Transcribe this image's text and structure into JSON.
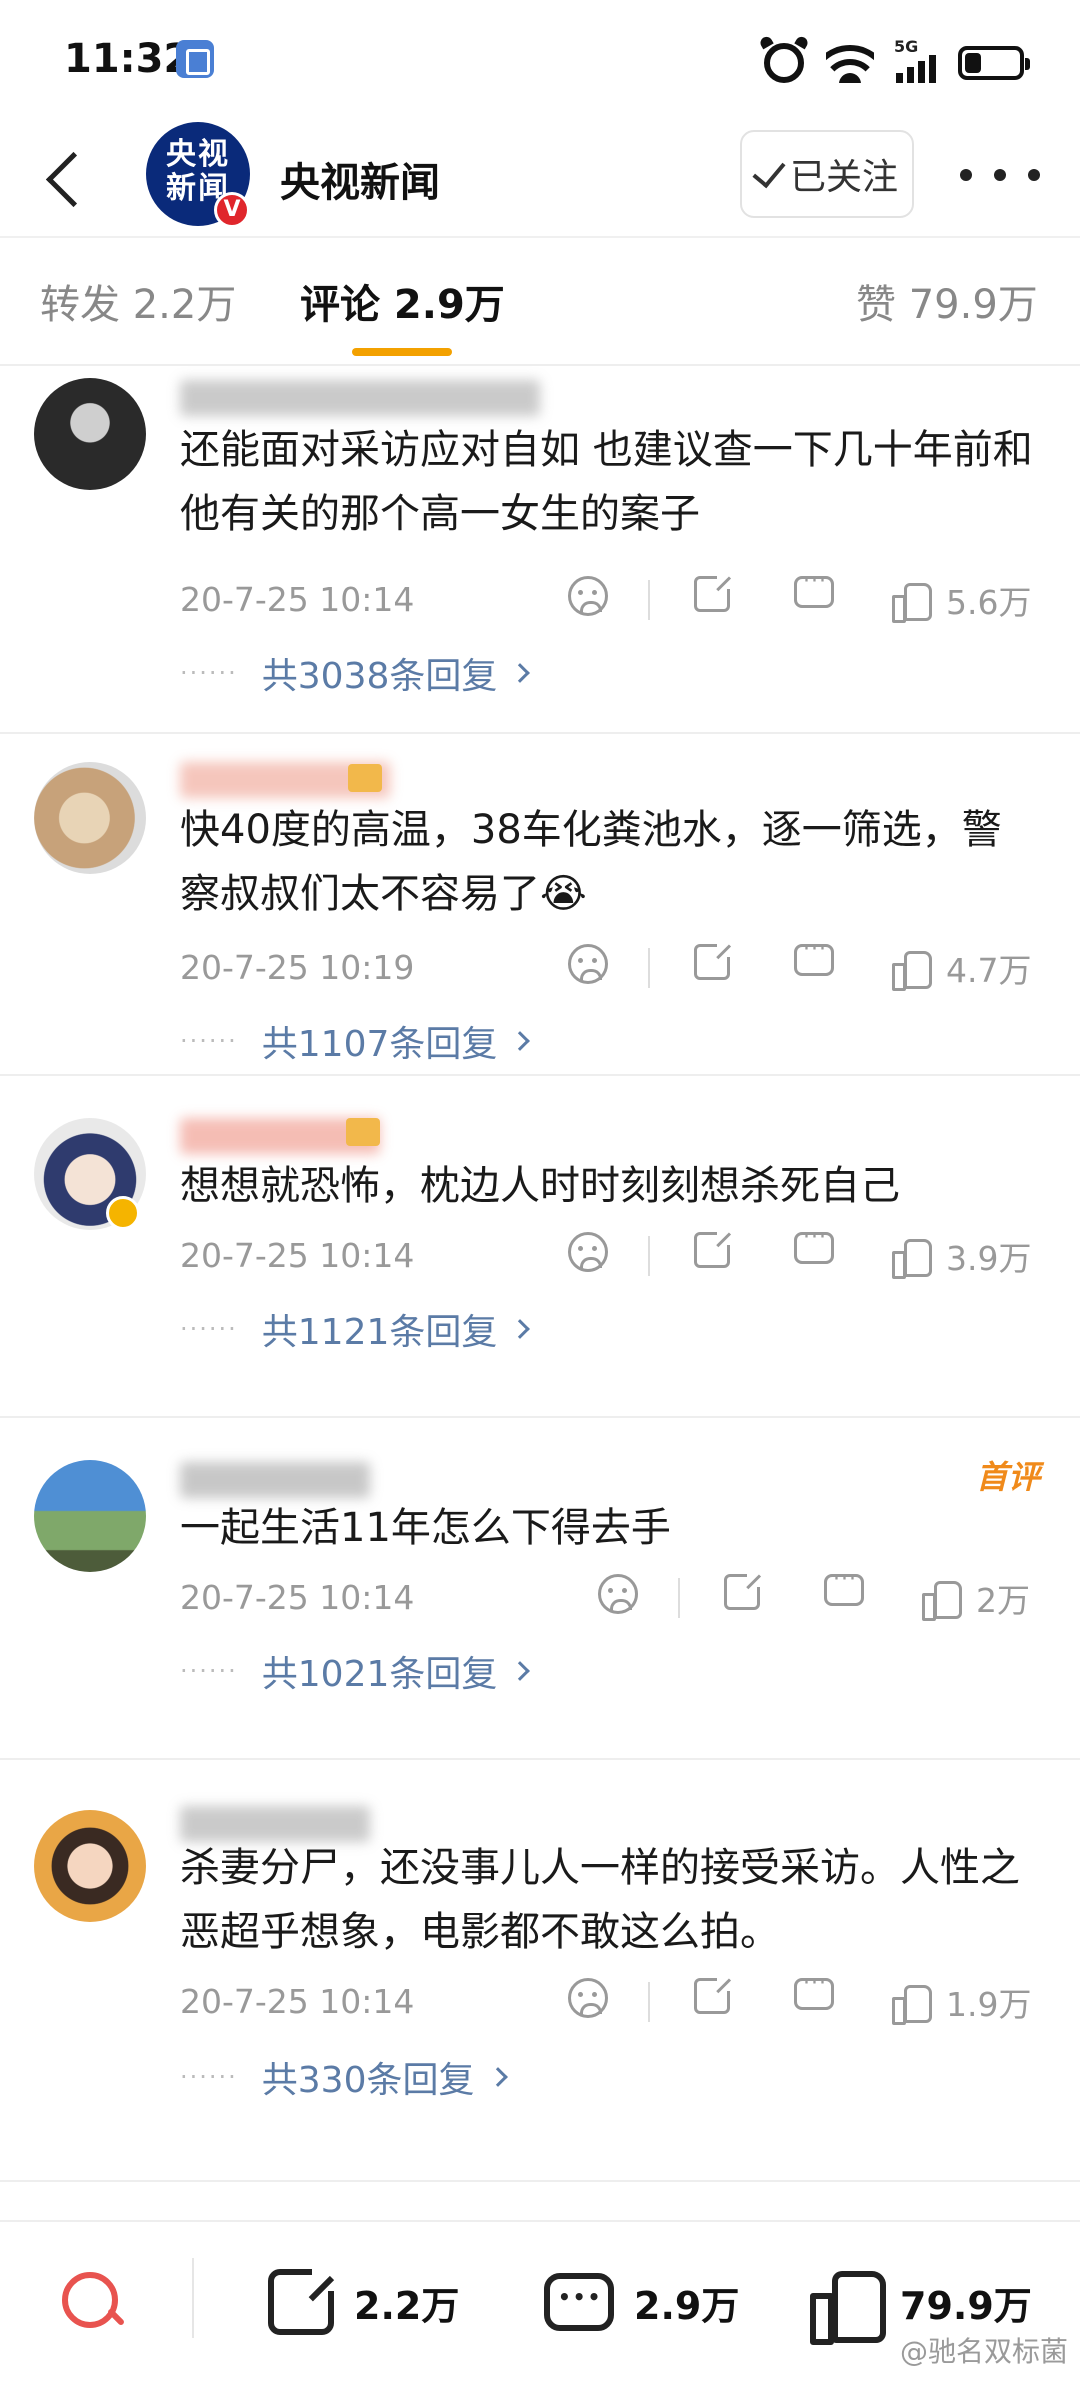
{
  "status_bar": {
    "time": "11:32",
    "network": "5G"
  },
  "header": {
    "account_name": "央视新闻",
    "logo_text_1": "央视",
    "logo_text_2": "新闻",
    "verified_mark": "V",
    "follow_label": "已关注"
  },
  "tabs": [
    {
      "label": "转发 2.2万"
    },
    {
      "label": "评论 2.9万"
    },
    {
      "label": "赞 79.9万"
    }
  ],
  "colors": {
    "accent": "#f3a100",
    "reply_link": "#5b7ba6",
    "first_comment_badge": "#f08a1a",
    "search_icon": "#e8534f"
  },
  "comments": [
    {
      "text": "还能面对采访应对自如 也建议查一下几十年前和他有关的那个高一女生的案子",
      "date": "20-7-25 10:14",
      "likes": "5.6万",
      "replies": "共3038条回复"
    },
    {
      "text": "快40度的高温，38车化粪池水，逐一筛选，警察叔叔们太不容易了😭",
      "date": "20-7-25 10:19",
      "likes": "4.7万",
      "replies": "共1107条回复"
    },
    {
      "text": "想想就恐怖，枕边人时时刻刻想杀死自己",
      "date": "20-7-25 10:14",
      "likes": "3.9万",
      "replies": "共1121条回复"
    },
    {
      "text": "一起生活11年怎么下得去手",
      "date": "20-7-25 10:14",
      "likes": "2万",
      "replies": "共1021条回复",
      "badge": "首评"
    },
    {
      "text": "杀妻分尸，还没事儿人一样的接受采访。人性之恶超乎想象，电影都不敢这么拍。",
      "date": "20-7-25 10:14",
      "likes": "1.9万",
      "replies": "共330条回复"
    }
  ],
  "bottom_bar": {
    "share_count": "2.2万",
    "comment_count": "2.9万",
    "like_count": "79.9万"
  },
  "watermark": "@驰名双标菌"
}
